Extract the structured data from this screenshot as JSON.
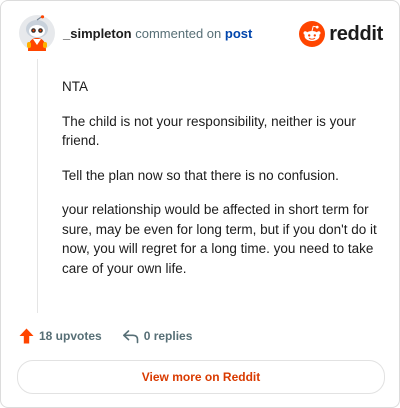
{
  "comment": {
    "username": "_simpleton",
    "action_text": "commented on",
    "post_link": "post",
    "paragraphs": [
      "NTA",
      "The child is not your responsibility, neither is your friend.",
      "Tell the plan now so that there is no confusion.",
      "your relationship would be affected in short term for sure, may be even for long term, but if you don't do it now, you will regret for a long time. you need to take care of your own life."
    ],
    "upvotes": "18 upvotes",
    "replies": "0 replies"
  },
  "brand": {
    "name": "reddit",
    "color": "#ff4500"
  },
  "footer": {
    "view_more": "View more on Reddit"
  },
  "icons": {
    "avatar": "snoo-avatar",
    "logo": "reddit-logo-icon",
    "upvote": "upvote-arrow-icon",
    "reply": "reply-arrow-icon"
  },
  "colors": {
    "accent": "#ff4500",
    "link": "#0045ac",
    "view_more": "#d93a00",
    "muted": "#576f76"
  }
}
